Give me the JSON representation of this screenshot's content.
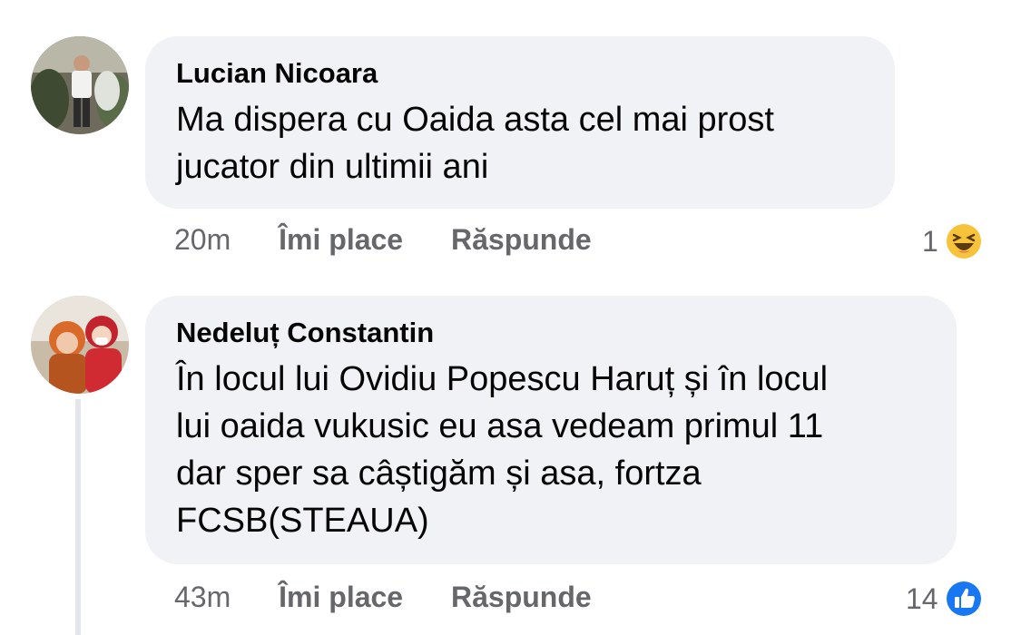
{
  "comments": [
    {
      "author": "Lucian Nicoara",
      "text_lines": [
        "Ma dispera cu Oaida asta cel mai prost",
        "jucator din ultimii ani"
      ],
      "time": "20m",
      "like_label": "Îmi place",
      "reply_label": "Răspunde",
      "reaction_count": "1",
      "reaction_icon": "haha-icon"
    },
    {
      "author": "Nedeluț Constantin",
      "text_lines": [
        "În locul lui Ovidiu Popescu Haruț și în locul",
        "lui oaida vukusic eu asa vedeam primul 11",
        "dar sper sa câștigăm și asa, fortza",
        "FCSB(STEAUA)"
      ],
      "time": "43m",
      "like_label": "Îmi place",
      "reply_label": "Răspunde",
      "reaction_count": "14",
      "reaction_icon": "like-icon"
    }
  ],
  "colors": {
    "bubble": "#f0f2f5",
    "meta_text": "#65676b",
    "like_blue": "#1877f2",
    "haha_yellow": "#f7c33b"
  }
}
